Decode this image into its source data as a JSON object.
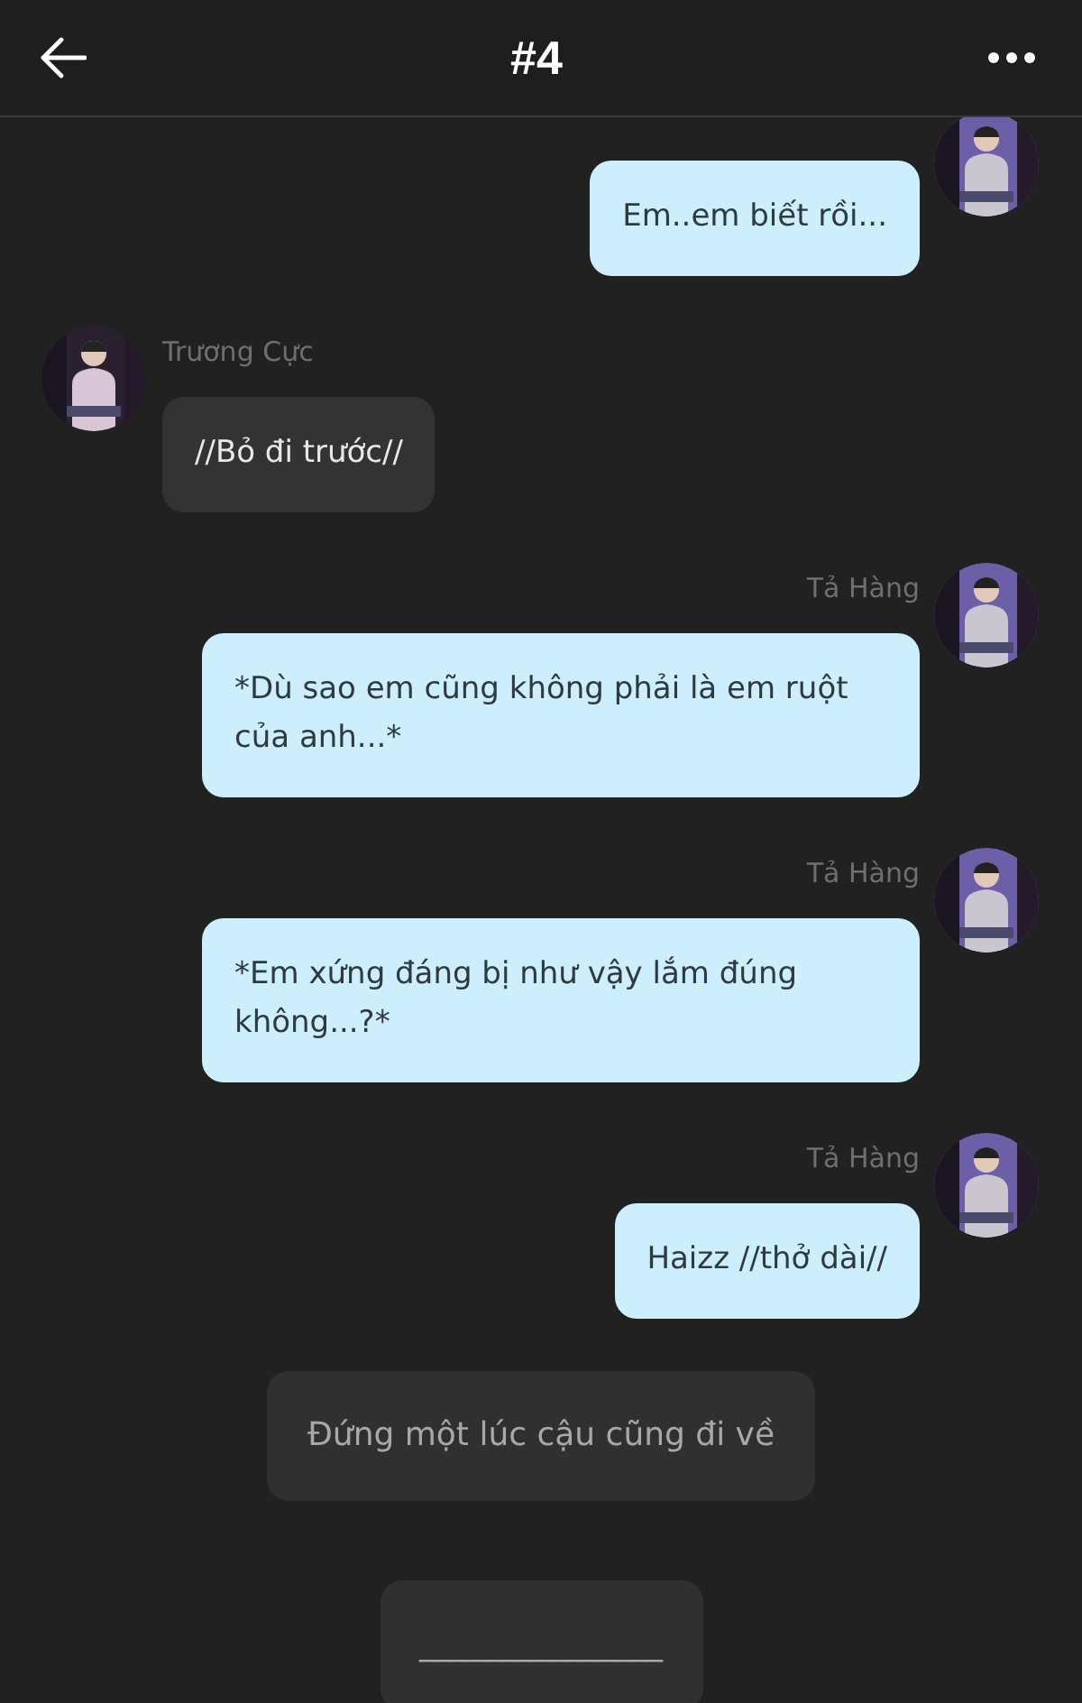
{
  "header": {
    "title": "#4"
  },
  "messages": [
    {
      "kind": "sent",
      "text": "Em..em biết rồi..."
    },
    {
      "kind": "received",
      "name": "Trương Cực",
      "text": "//Bỏ đi trước//"
    },
    {
      "kind": "sent",
      "name": "Tả Hàng",
      "text": "*Dù sao em cũng không phải là em ruột của anh...*"
    },
    {
      "kind": "sent",
      "name": "Tả Hàng",
      "text": "*Em xứng đáng bị như vậy lắm đúng không...?*"
    },
    {
      "kind": "sent",
      "name": "Tả Hàng",
      "text": "Haizz //thở dài//"
    },
    {
      "kind": "narration",
      "text": "Đứng một lúc cậu cũng đi về"
    },
    {
      "kind": "narration",
      "text": "_______________"
    }
  ]
}
